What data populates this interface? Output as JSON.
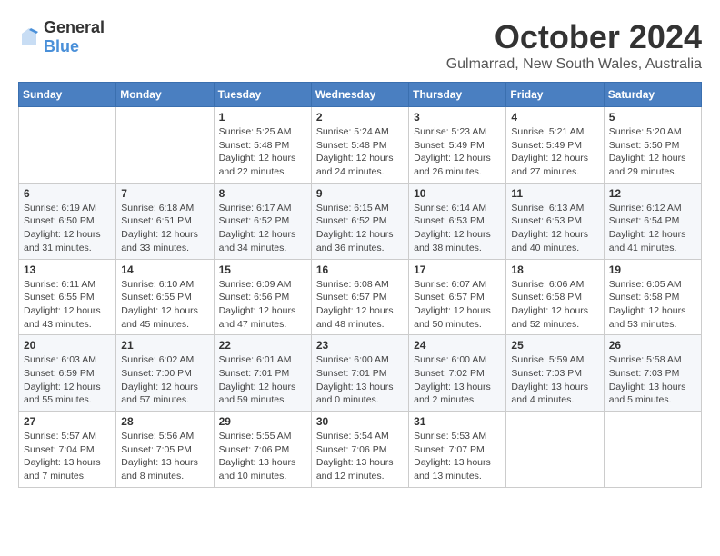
{
  "logo": {
    "text_general": "General",
    "text_blue": "Blue"
  },
  "header": {
    "month_title": "October 2024",
    "subtitle": "Gulmarrad, New South Wales, Australia"
  },
  "weekdays": [
    "Sunday",
    "Monday",
    "Tuesday",
    "Wednesday",
    "Thursday",
    "Friday",
    "Saturday"
  ],
  "weeks": [
    [
      {
        "day": "",
        "info": ""
      },
      {
        "day": "",
        "info": ""
      },
      {
        "day": "1",
        "info": "Sunrise: 5:25 AM\nSunset: 5:48 PM\nDaylight: 12 hours and 22 minutes."
      },
      {
        "day": "2",
        "info": "Sunrise: 5:24 AM\nSunset: 5:48 PM\nDaylight: 12 hours and 24 minutes."
      },
      {
        "day": "3",
        "info": "Sunrise: 5:23 AM\nSunset: 5:49 PM\nDaylight: 12 hours and 26 minutes."
      },
      {
        "day": "4",
        "info": "Sunrise: 5:21 AM\nSunset: 5:49 PM\nDaylight: 12 hours and 27 minutes."
      },
      {
        "day": "5",
        "info": "Sunrise: 5:20 AM\nSunset: 5:50 PM\nDaylight: 12 hours and 29 minutes."
      }
    ],
    [
      {
        "day": "6",
        "info": "Sunrise: 6:19 AM\nSunset: 6:50 PM\nDaylight: 12 hours and 31 minutes."
      },
      {
        "day": "7",
        "info": "Sunrise: 6:18 AM\nSunset: 6:51 PM\nDaylight: 12 hours and 33 minutes."
      },
      {
        "day": "8",
        "info": "Sunrise: 6:17 AM\nSunset: 6:52 PM\nDaylight: 12 hours and 34 minutes."
      },
      {
        "day": "9",
        "info": "Sunrise: 6:15 AM\nSunset: 6:52 PM\nDaylight: 12 hours and 36 minutes."
      },
      {
        "day": "10",
        "info": "Sunrise: 6:14 AM\nSunset: 6:53 PM\nDaylight: 12 hours and 38 minutes."
      },
      {
        "day": "11",
        "info": "Sunrise: 6:13 AM\nSunset: 6:53 PM\nDaylight: 12 hours and 40 minutes."
      },
      {
        "day": "12",
        "info": "Sunrise: 6:12 AM\nSunset: 6:54 PM\nDaylight: 12 hours and 41 minutes."
      }
    ],
    [
      {
        "day": "13",
        "info": "Sunrise: 6:11 AM\nSunset: 6:55 PM\nDaylight: 12 hours and 43 minutes."
      },
      {
        "day": "14",
        "info": "Sunrise: 6:10 AM\nSunset: 6:55 PM\nDaylight: 12 hours and 45 minutes."
      },
      {
        "day": "15",
        "info": "Sunrise: 6:09 AM\nSunset: 6:56 PM\nDaylight: 12 hours and 47 minutes."
      },
      {
        "day": "16",
        "info": "Sunrise: 6:08 AM\nSunset: 6:57 PM\nDaylight: 12 hours and 48 minutes."
      },
      {
        "day": "17",
        "info": "Sunrise: 6:07 AM\nSunset: 6:57 PM\nDaylight: 12 hours and 50 minutes."
      },
      {
        "day": "18",
        "info": "Sunrise: 6:06 AM\nSunset: 6:58 PM\nDaylight: 12 hours and 52 minutes."
      },
      {
        "day": "19",
        "info": "Sunrise: 6:05 AM\nSunset: 6:58 PM\nDaylight: 12 hours and 53 minutes."
      }
    ],
    [
      {
        "day": "20",
        "info": "Sunrise: 6:03 AM\nSunset: 6:59 PM\nDaylight: 12 hours and 55 minutes."
      },
      {
        "day": "21",
        "info": "Sunrise: 6:02 AM\nSunset: 7:00 PM\nDaylight: 12 hours and 57 minutes."
      },
      {
        "day": "22",
        "info": "Sunrise: 6:01 AM\nSunset: 7:01 PM\nDaylight: 12 hours and 59 minutes."
      },
      {
        "day": "23",
        "info": "Sunrise: 6:00 AM\nSunset: 7:01 PM\nDaylight: 13 hours and 0 minutes."
      },
      {
        "day": "24",
        "info": "Sunrise: 6:00 AM\nSunset: 7:02 PM\nDaylight: 13 hours and 2 minutes."
      },
      {
        "day": "25",
        "info": "Sunrise: 5:59 AM\nSunset: 7:03 PM\nDaylight: 13 hours and 4 minutes."
      },
      {
        "day": "26",
        "info": "Sunrise: 5:58 AM\nSunset: 7:03 PM\nDaylight: 13 hours and 5 minutes."
      }
    ],
    [
      {
        "day": "27",
        "info": "Sunrise: 5:57 AM\nSunset: 7:04 PM\nDaylight: 13 hours and 7 minutes."
      },
      {
        "day": "28",
        "info": "Sunrise: 5:56 AM\nSunset: 7:05 PM\nDaylight: 13 hours and 8 minutes."
      },
      {
        "day": "29",
        "info": "Sunrise: 5:55 AM\nSunset: 7:06 PM\nDaylight: 13 hours and 10 minutes."
      },
      {
        "day": "30",
        "info": "Sunrise: 5:54 AM\nSunset: 7:06 PM\nDaylight: 13 hours and 12 minutes."
      },
      {
        "day": "31",
        "info": "Sunrise: 5:53 AM\nSunset: 7:07 PM\nDaylight: 13 hours and 13 minutes."
      },
      {
        "day": "",
        "info": ""
      },
      {
        "day": "",
        "info": ""
      }
    ]
  ]
}
